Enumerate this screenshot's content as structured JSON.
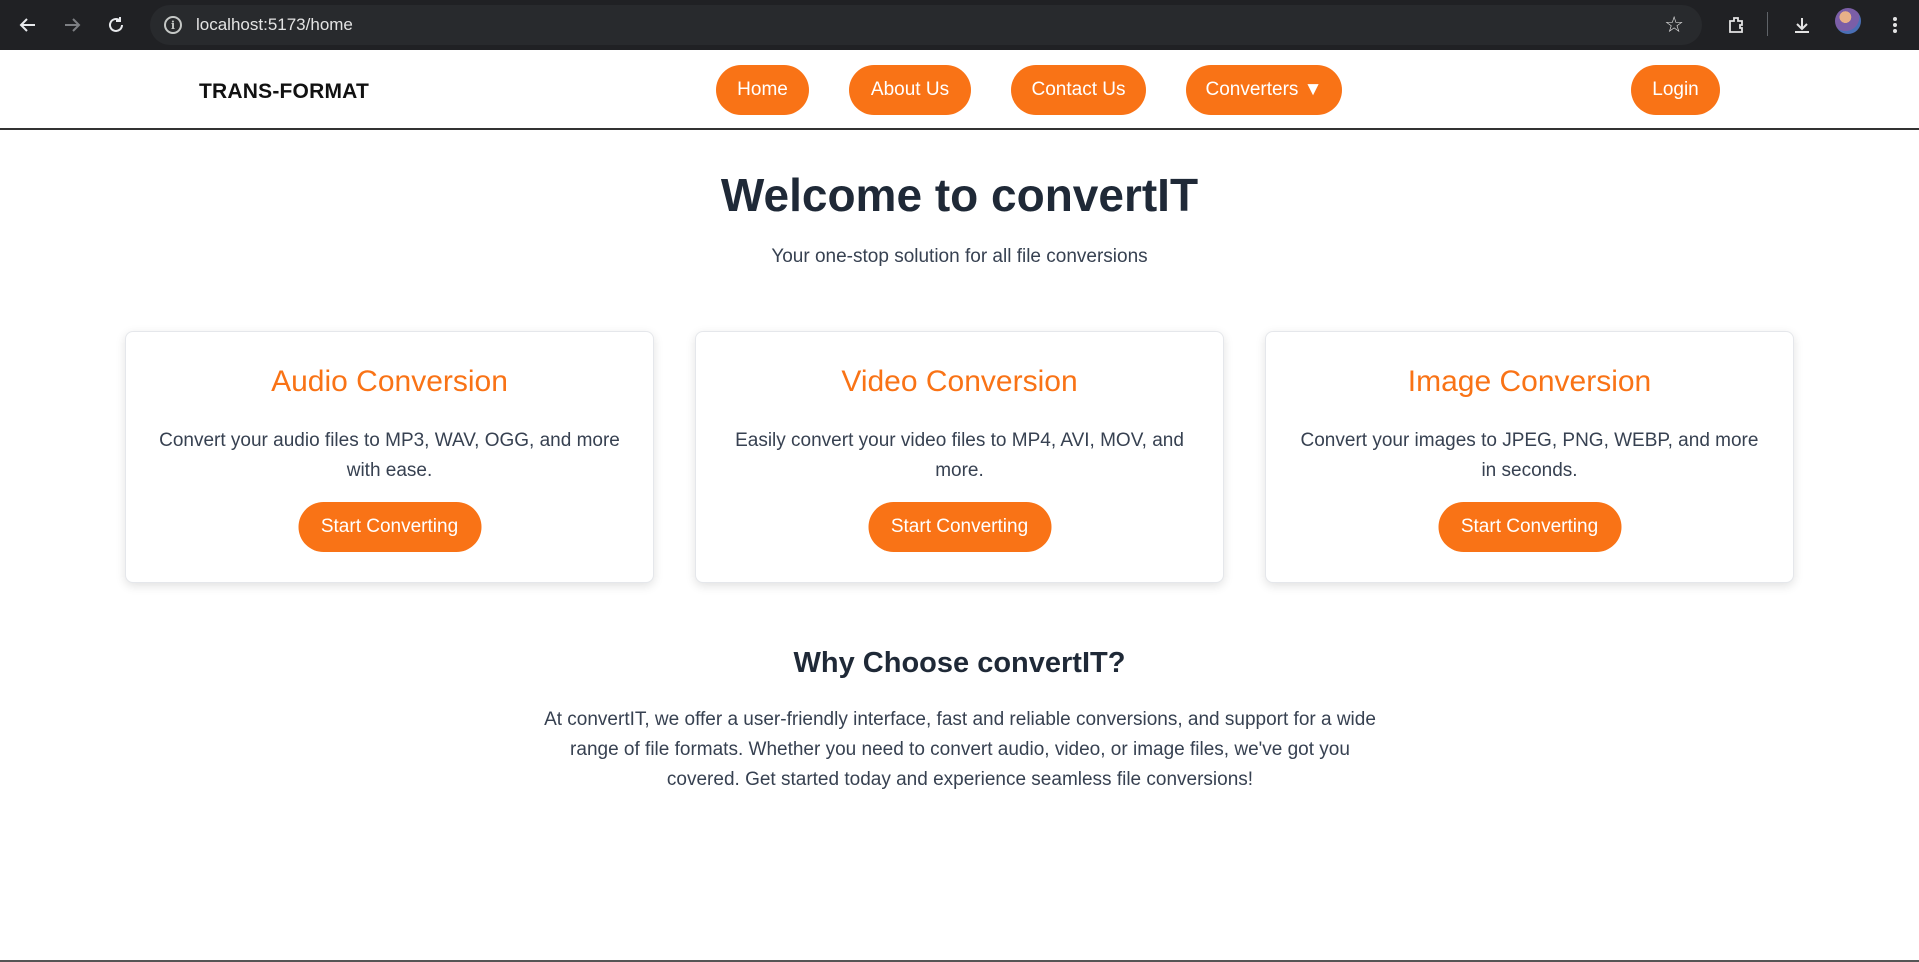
{
  "browser": {
    "url": "localhost:5173/home",
    "back_icon": "arrow-left-icon",
    "forward_icon": "arrow-right-icon",
    "reload_icon": "reload-icon"
  },
  "nav": {
    "brand": "TRANS-FORMAT",
    "home": "Home",
    "about": "About Us",
    "contact": "Contact Us",
    "converters": "Converters ▼",
    "login": "Login",
    "accent_color": "#f97316"
  },
  "hero": {
    "title": "Welcome to convertIT",
    "subtitle": "Your one-stop solution for all file conversions"
  },
  "cards": [
    {
      "title": "Audio Conversion",
      "description": "Convert your audio files to MP3, WAV, OGG, and more with ease.",
      "button": "Start Converting"
    },
    {
      "title": "Video Conversion",
      "description": "Easily convert your video files to MP4, AVI, MOV, and more.",
      "button": "Start Converting"
    },
    {
      "title": "Image Conversion",
      "description": "Convert your images to JPEG, PNG, WEBP, and more in seconds.",
      "button": "Start Converting"
    }
  ],
  "why": {
    "title": "Why Choose convertIT?",
    "text": "At convertIT, we offer a user-friendly interface, fast and reliable conversions, and support for a wide range of file formats. Whether you need to convert audio, video, or image files, we've got you covered. Get started today and experience seamless file conversions!"
  }
}
